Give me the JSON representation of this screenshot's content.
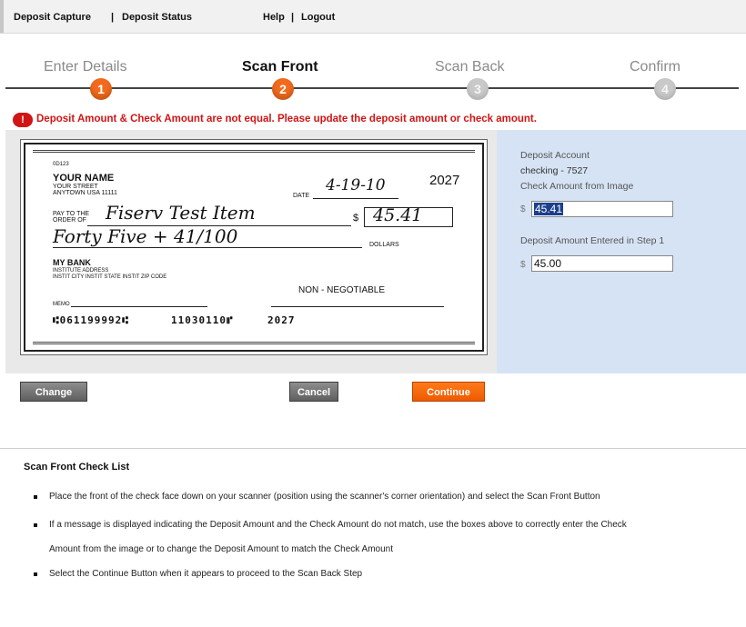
{
  "topnav": {
    "deposit_capture": "Deposit Capture",
    "deposit_status": "Deposit Status",
    "help": "Help",
    "logout": "Logout",
    "separator": "|"
  },
  "steps": [
    {
      "label": "Enter Details",
      "number": "1",
      "state": "done"
    },
    {
      "label": "Scan Front",
      "number": "2",
      "state": "current"
    },
    {
      "label": "Scan Back",
      "number": "3",
      "state": "todo"
    },
    {
      "label": "Confirm",
      "number": "4",
      "state": "todo"
    }
  ],
  "error": {
    "icon": "exclamation-icon",
    "icon_glyph": "!",
    "message": "Deposit Amount & Check Amount are not equal. Please update the deposit amount or check amount."
  },
  "check_image": {
    "check_no_small": "0D123",
    "name": "YOUR NAME",
    "street": "YOUR STREET",
    "city": "ANYTOWN USA 11111",
    "check_number": "2027",
    "date_label": "DATE",
    "date": "4-19-10",
    "pay_to_label_1": "PAY TO THE",
    "pay_to_label_2": "ORDER OF",
    "payee": "Fiserv Test Item",
    "dollar_sign": "$",
    "amount": "45.41",
    "written_amount": "Forty Five + 41/100",
    "dollars_label": "DOLLARS",
    "bank_name": "MY BANK",
    "bank_address_1": "INSTITUTE ADDRESS",
    "bank_address_2": "INSTIT CITY INSTIT STATE INSTIT ZIP CODE",
    "non_negotiable": "NON - NEGOTIABLE",
    "memo_label": "MEMO",
    "micr_routing": "⑆061199992⑆",
    "micr_account": "11030110⑈",
    "micr_check": "2027"
  },
  "deposit_panel": {
    "account_label": "Deposit Account",
    "account_value": "checking - 7527",
    "check_amount_label": "Check Amount from Image",
    "currency_symbol": "$",
    "check_amount_value": "45.41",
    "deposit_amount_label": "Deposit Amount Entered in Step 1",
    "deposit_amount_value": "45.00"
  },
  "buttons": {
    "change": "Change",
    "cancel": "Cancel",
    "continue": "Continue"
  },
  "checklist": {
    "title": "Scan Front Check List",
    "items": [
      "Place the front of the check face down on your scanner (position using the scanner's corner orientation) and select the Scan Front Button",
      "If a message is displayed indicating the Deposit Amount and the Check Amount do not match, use the boxes above to correctly enter the Check",
      "Amount from the image or to change the Deposit Amount to match the Check Amount",
      "Select the Continue Button when it appears to proceed to the Scan Back Step"
    ]
  },
  "colors": {
    "accent_orange": "#f26b1d",
    "error_red": "#d11515",
    "side_panel_blue": "#d6e3f4",
    "step_todo_gray": "#c9c9c9"
  }
}
